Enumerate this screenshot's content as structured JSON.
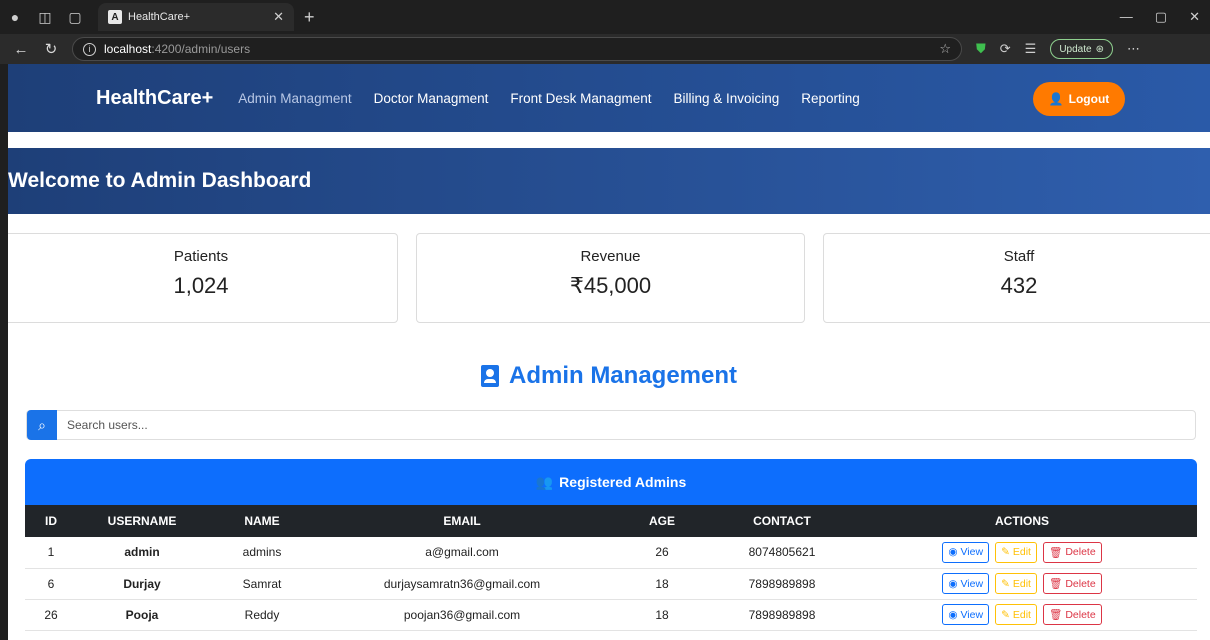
{
  "browser": {
    "tab_title": "HealthCare+",
    "tab_favicon": "A",
    "url_host": "localhost",
    "url_path": ":4200/admin/users",
    "update_label": "Update"
  },
  "nav": {
    "brand": "HealthCare+",
    "links": [
      "Admin Managment",
      "Doctor Managment",
      "Front Desk Managment",
      "Billing & Invoicing",
      "Reporting"
    ],
    "logout_label": "Logout"
  },
  "hero": {
    "title": "Welcome to Admin Dashboard"
  },
  "stats": [
    {
      "label": "Patients",
      "value": "1,024"
    },
    {
      "label": "Revenue",
      "value": "₹45,000"
    },
    {
      "label": "Staff",
      "value": "432"
    }
  ],
  "section": {
    "title": "Admin Management"
  },
  "search": {
    "placeholder": "Search users..."
  },
  "table": {
    "title": "Registered Admins",
    "columns": [
      "ID",
      "USERNAME",
      "NAME",
      "EMAIL",
      "AGE",
      "CONTACT",
      "ACTIONS"
    ],
    "rows": [
      {
        "id": "1",
        "username": "admin",
        "name": "admins",
        "email": "a@gmail.com",
        "age": "26",
        "contact": "8074805621"
      },
      {
        "id": "6",
        "username": "Durjay",
        "name": "Samrat",
        "email": "durjaysamratn36@gmail.com",
        "age": "18",
        "contact": "7898989898"
      },
      {
        "id": "26",
        "username": "Pooja",
        "name": "Reddy",
        "email": "poojan36@gmail.com",
        "age": "18",
        "contact": "7898989898"
      }
    ],
    "action_labels": {
      "view": "View",
      "edit": "Edit",
      "delete": "Delete"
    }
  },
  "colors": {
    "primary": "#0d6efd",
    "navbar": "#1e3f78",
    "logout": "#ff7a00",
    "warning": "#ffc107",
    "danger": "#dc3545"
  }
}
